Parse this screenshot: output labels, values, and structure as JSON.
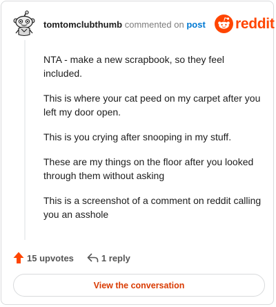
{
  "header": {
    "username": "tomtomclubthumb",
    "action_text": "commented on",
    "post_link": "post"
  },
  "brand": {
    "wordmark": "reddit",
    "color": "#ff4500"
  },
  "comment": {
    "paragraphs": [
      "NTA - make a new scrapbook, so they feel included.",
      "This is where your cat peed on my carpet after you left my door open.",
      "This is you crying after snooping in my stuff.",
      "These are my things on the floor after you looked through them without asking",
      "This is a screenshot of a comment on reddit calling you an asshole"
    ]
  },
  "actions": {
    "upvotes_label": "15 upvotes",
    "replies_label": "1 reply",
    "upvote_icon": "upvote-arrow-icon",
    "reply_icon": "reply-arrow-icon",
    "upvote_color": "#ff4500"
  },
  "cta": {
    "label": "View the conversation",
    "color": "#d93a00"
  }
}
